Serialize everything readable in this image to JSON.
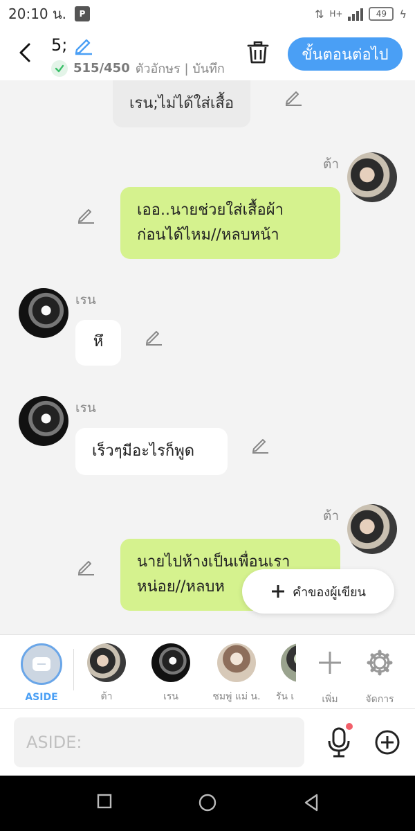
{
  "status": {
    "time": "20:10 น.",
    "network": "H+",
    "battery": "49"
  },
  "header": {
    "title": "5;",
    "char_count": "515/450",
    "sub_label": "ตัวอักษร | บันทึก",
    "next_button": "ขั้นตอนต่อไป"
  },
  "chat": {
    "messages": [
      {
        "speaker": "",
        "text": "เรน;ไม่ได้ใส่เสื้อ",
        "side": "center"
      },
      {
        "speaker": "ต้า",
        "text_line1": "เออ..นายช่วยใส่เสื้อผ้า",
        "text_line2": "ก่อนได้ไหม//หลบหน้า",
        "side": "right"
      },
      {
        "speaker": "เรน",
        "text": "หึ",
        "side": "left"
      },
      {
        "speaker": "เรน",
        "text": "เร็วๆมีอะไรก็พูด",
        "side": "left"
      },
      {
        "speaker": "ต้า",
        "text_line1": "นายไปห้างเป็นเพื่อนเรา",
        "text_line2": "หน่อย//หลบห",
        "side": "right"
      }
    ],
    "fab_label": "คำของผู้เขียน"
  },
  "characters": {
    "aside_label": "ASIDE",
    "items": [
      {
        "label": "ต้า"
      },
      {
        "label": "เรน"
      },
      {
        "label": "ชมพู่ แม่ น."
      },
      {
        "label": "รัน เ"
      }
    ],
    "add_label": "เพิ่ม",
    "manage_label": "จัดการ"
  },
  "input": {
    "placeholder": "ASIDE:"
  },
  "colors": {
    "accent": "#4a9ff5",
    "green_bubble": "#d5f28e",
    "white_bubble": "#ffffff",
    "mic_dot": "#f25f6a"
  }
}
